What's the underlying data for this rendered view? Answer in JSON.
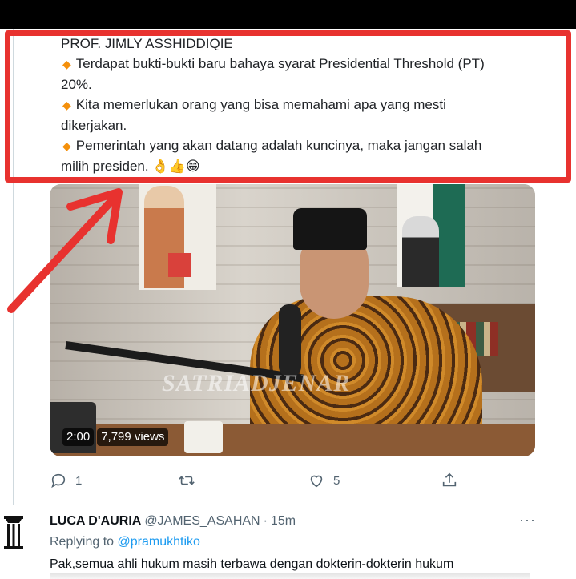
{
  "tweet": {
    "lines": [
      "PROF. JIMLY ASSHIDDIQIE",
      "Terdapat bukti-bukti baru bahaya syarat Presidential Threshold (PT)",
      "20%.",
      "Kita memerlukan orang yang bisa memahami apa yang mesti",
      "dikerjakan.",
      "Pemerintah yang akan datang adalah kuncinya, maka jangan salah",
      "milih presiden."
    ],
    "emojis": "👌👍😁"
  },
  "video": {
    "watermark": "SATRIADJENAR",
    "duration": "2:00",
    "views": "7,799 views"
  },
  "actions": {
    "reply_count": "1",
    "retweet_count": "",
    "like_count": "5"
  },
  "reply": {
    "name": "LUCA D'AURIA",
    "handle": "@JAMES_ASAHAN",
    "dot": "·",
    "time": "15m",
    "more": "···",
    "replying_prefix": "Replying to",
    "replying_to": "@pramukhtiko",
    "text": "Pak,semua ahli hukum masih terbawa dengan dokterin-dokterin hukum"
  },
  "colors": {
    "highlight": "#e8322f",
    "bullet": "#f4900c",
    "link": "#1d9bf0",
    "muted": "#536471"
  }
}
